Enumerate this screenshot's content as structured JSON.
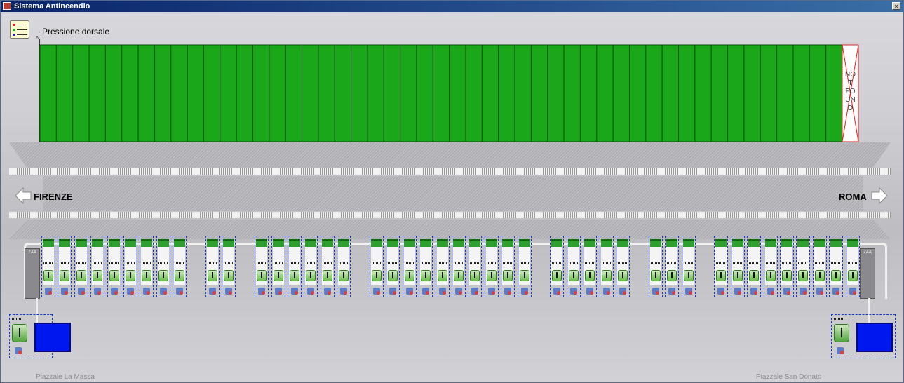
{
  "window": {
    "title": "Sistema Antincendio",
    "close_glyph": "×"
  },
  "chart": {
    "title": "Pressione dorsale",
    "bar_color": "#1aa81a",
    "bar_border": "#0b4f0b",
    "bar_count": 49,
    "not_found_text": "NO T FO UN D"
  },
  "chart_data": {
    "type": "bar",
    "title": "Pressione dorsale",
    "values": [
      1,
      1,
      1,
      1,
      1,
      1,
      1,
      1,
      1,
      1,
      1,
      1,
      1,
      1,
      1,
      1,
      1,
      1,
      1,
      1,
      1,
      1,
      1,
      1,
      1,
      1,
      1,
      1,
      1,
      1,
      1,
      1,
      1,
      1,
      1,
      1,
      1,
      1,
      1,
      1,
      1,
      1,
      1,
      1,
      1,
      1,
      1,
      1,
      1
    ],
    "missing_last": "NOT FOUND",
    "ylim": [
      0,
      1
    ],
    "grid": false,
    "legend": "none"
  },
  "directions": {
    "left": "FIRENZE",
    "right": "ROMA"
  },
  "ends": {
    "left_tag": "ZAA",
    "right_tag": "ZAA"
  },
  "units": {
    "groups": [
      9,
      2,
      6,
      10,
      5,
      3,
      9
    ],
    "colors": {
      "cap": "#2fa02f",
      "outline": "#1a3acc",
      "tank": "#0018f0"
    }
  },
  "stations": {
    "left": {
      "place": "Piazzale La Massa"
    },
    "right": {
      "place": "Piazzale San Donato"
    }
  }
}
